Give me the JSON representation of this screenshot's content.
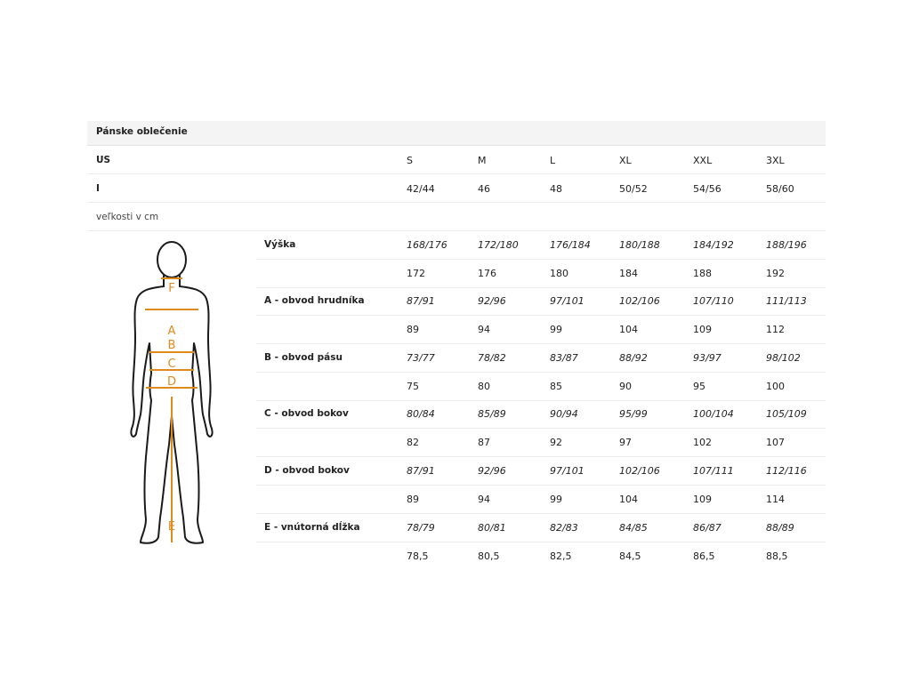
{
  "header": {
    "title": "Pánske oblečenie"
  },
  "us_row": {
    "label": "US",
    "sizes": [
      "S",
      "M",
      "L",
      "XL",
      "XXL",
      "3XL"
    ]
  },
  "i_row": {
    "label": "I",
    "sizes": [
      "42/44",
      "46",
      "48",
      "50/52",
      "54/56",
      "58/60"
    ]
  },
  "units_note": "veľkosti v cm",
  "figure_labels": {
    "f": "F",
    "a": "A",
    "b": "B",
    "c": "C",
    "d": "D",
    "e": "E"
  },
  "colors": {
    "accent": "#e08a1e",
    "outline": "#1a1a1a",
    "header_bg": "#f4f4f5"
  },
  "measurements": [
    {
      "label": "Výška",
      "range": [
        "168/176",
        "172/180",
        "176/184",
        "180/188",
        "184/192",
        "188/196"
      ],
      "value": [
        "172",
        "176",
        "180",
        "184",
        "188",
        "192"
      ]
    },
    {
      "label": "A - obvod hrudníka",
      "range": [
        "87/91",
        "92/96",
        "97/101",
        "102/106",
        "107/110",
        "111/113"
      ],
      "value": [
        "89",
        "94",
        "99",
        "104",
        "109",
        "112"
      ]
    },
    {
      "label": "B - obvod pásu",
      "range": [
        "73/77",
        "78/82",
        "83/87",
        "88/92",
        "93/97",
        "98/102"
      ],
      "value": [
        "75",
        "80",
        "85",
        "90",
        "95",
        "100"
      ]
    },
    {
      "label": "C - obvod bokov",
      "range": [
        "80/84",
        "85/89",
        "90/94",
        "95/99",
        "100/104",
        "105/109"
      ],
      "value": [
        "82",
        "87",
        "92",
        "97",
        "102",
        "107"
      ]
    },
    {
      "label": "D - obvod bokov",
      "range": [
        "87/91",
        "92/96",
        "97/101",
        "102/106",
        "107/111",
        "112/116"
      ],
      "value": [
        "89",
        "94",
        "99",
        "104",
        "109",
        "114"
      ]
    },
    {
      "label": "E - vnútorná dĺžka",
      "range": [
        "78/79",
        "80/81",
        "82/83",
        "84/85",
        "86/87",
        "88/89"
      ],
      "value": [
        "78,5",
        "80,5",
        "82,5",
        "84,5",
        "86,5",
        "88,5"
      ]
    }
  ]
}
